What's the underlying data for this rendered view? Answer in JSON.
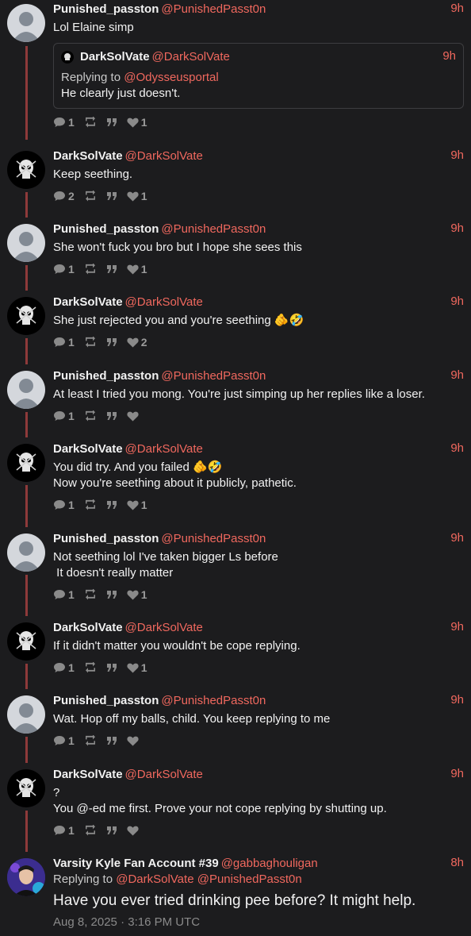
{
  "posts": [
    {
      "name": "Punished_passton",
      "handle": "@PunishedPasst0n",
      "time": "9h",
      "avatar": "default",
      "text": "Lol Elaine simp",
      "quote": {
        "name": "DarkSolVate",
        "handle": "@DarkSolVate",
        "time": "9h",
        "replying_label": "Replying to",
        "replying_to": "@Odysseusportal",
        "text": "He clearly just doesn't."
      },
      "replies": "1",
      "likes": "1"
    },
    {
      "name": "DarkSolVate",
      "handle": "@DarkSolVate",
      "time": "9h",
      "avatar": "skull",
      "text": "Keep seething.",
      "replies": "2",
      "likes": "1"
    },
    {
      "name": "Punished_passton",
      "handle": "@PunishedPasst0n",
      "time": "9h",
      "avatar": "default",
      "text": "She won't fuck you bro but I hope she sees this",
      "replies": "1",
      "likes": "1"
    },
    {
      "name": "DarkSolVate",
      "handle": "@DarkSolVate",
      "time": "9h",
      "avatar": "skull",
      "text": "She just rejected you and you're seething 🫵🤣",
      "replies": "1",
      "likes": "2"
    },
    {
      "name": "Punished_passton",
      "handle": "@PunishedPasst0n",
      "time": "9h",
      "avatar": "default",
      "text": "At least I tried you mong. You're just simping up her replies like a loser.",
      "replies": "1",
      "likes": ""
    },
    {
      "name": "DarkSolVate",
      "handle": "@DarkSolVate",
      "time": "9h",
      "avatar": "skull",
      "text": "You did try. And you failed 🫵🤣\nNow you're seething about it publicly, pathetic.",
      "replies": "1",
      "likes": "1"
    },
    {
      "name": "Punished_passton",
      "handle": "@PunishedPasst0n",
      "time": "9h",
      "avatar": "default",
      "text": "Not seething lol I've taken bigger Ls before\n It doesn't really matter",
      "replies": "1",
      "likes": "1"
    },
    {
      "name": "DarkSolVate",
      "handle": "@DarkSolVate",
      "time": "9h",
      "avatar": "skull",
      "text": "If it didn't matter you wouldn't be cope replying.",
      "replies": "1",
      "likes": "1"
    },
    {
      "name": "Punished_passton",
      "handle": "@PunishedPasst0n",
      "time": "9h",
      "avatar": "default",
      "text": "Wat. Hop off my balls, child. You keep replying to me",
      "replies": "1",
      "likes": ""
    },
    {
      "name": "DarkSolVate",
      "handle": "@DarkSolVate",
      "time": "9h",
      "avatar": "skull",
      "text": "?\nYou @-ed me first. Prove your not cope replying by shutting up.",
      "replies": "1",
      "likes": ""
    }
  ],
  "main_post": {
    "name": "Varsity Kyle Fan Account #39",
    "handle": "@gabbaghouligan",
    "time": "8h",
    "replying_label": "Replying to",
    "mentions": [
      "@DarkSolVate",
      "@PunishedPasst0n"
    ],
    "text": "Have you ever tried drinking pee before? It might help.",
    "date": "Aug 8, 2025 · 3:16 PM UTC"
  },
  "colors": {
    "background": "#1c1c1e",
    "accent": "#f0685e",
    "thread_line": "#8e3a3a",
    "muted": "#8a8a8a"
  },
  "icons": {
    "reply": "comment-icon",
    "retweet": "retweet-icon",
    "quote": "quote-icon",
    "like": "heart-icon"
  }
}
